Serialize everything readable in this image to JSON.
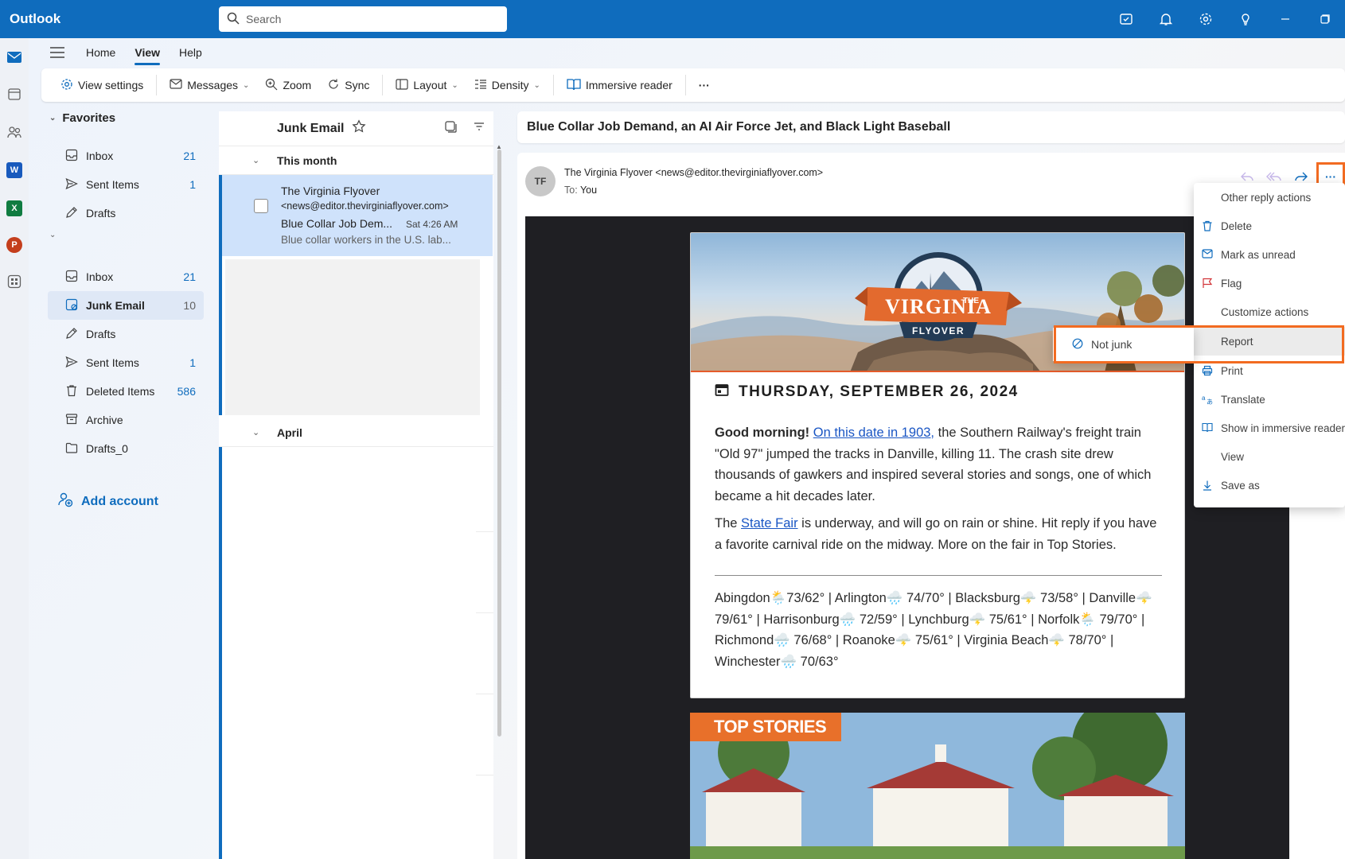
{
  "app": {
    "name": "Outlook"
  },
  "search": {
    "placeholder": "Search"
  },
  "titlebar": {
    "icons": [
      "my-day-icon",
      "bell-icon",
      "gear-icon",
      "lightbulb-icon",
      "minimize-icon",
      "restore-icon"
    ]
  },
  "rail": {
    "apps": [
      "mail",
      "calendar",
      "people",
      "word",
      "excel",
      "powerpoint",
      "apps"
    ]
  },
  "ribbon": {
    "tabs": [
      {
        "label": "Home"
      },
      {
        "label": "View",
        "active": true
      },
      {
        "label": "Help"
      }
    ],
    "toolbar": {
      "view_settings": "View settings",
      "messages": "Messages",
      "zoom": "Zoom",
      "sync": "Sync",
      "layout": "Layout",
      "density": "Density",
      "immersive_reader": "Immersive reader",
      "more": "···"
    }
  },
  "folders": {
    "favorites_label": "Favorites",
    "favorites": [
      {
        "label": "Inbox",
        "count": "21"
      },
      {
        "label": "Sent Items",
        "count": "1"
      },
      {
        "label": "Drafts",
        "count": ""
      }
    ],
    "account": [
      {
        "label": "Inbox",
        "count": "21"
      },
      {
        "label": "Junk Email",
        "count": "10",
        "selected": true
      },
      {
        "label": "Drafts",
        "count": ""
      },
      {
        "label": "Sent Items",
        "count": "1"
      },
      {
        "label": "Deleted Items",
        "count": "586"
      },
      {
        "label": "Archive",
        "count": ""
      },
      {
        "label": "Drafts_0",
        "count": ""
      }
    ],
    "add_account": "Add account"
  },
  "message_list": {
    "title": "Junk Email",
    "groups": [
      "This month",
      "April"
    ],
    "messages": [
      {
        "from": "The Virginia Flyover",
        "address": "<news@editor.thevirginiaflyover.com>",
        "subject": "Blue Collar Job Dem...",
        "time": "Sat 4:26 AM",
        "preview": "Blue collar workers in the U.S. lab..."
      }
    ]
  },
  "reading_pane": {
    "subject": "Blue Collar Job Demand, an AI Air Force Jet, and Black Light Baseball",
    "avatar_initials": "TF",
    "sender": "The Virginia Flyover <news@editor.thevirginiaflyover.com>",
    "to_label": "To:",
    "to": "You",
    "more_actions": "···"
  },
  "email": {
    "logo_top": "THE",
    "logo_main": "VIRGINIA",
    "logo_bottom": "FLYOVER",
    "date": "THURSDAY, SEPTEMBER 26, 2024",
    "greeting": "Good morning!",
    "link1": "On this date in 1903,",
    "para1_rest": " the Southern Railway's freight train \"Old 97\" jumped the tracks in Danville, killing 11. The crash site drew thousands of gawkers and inspired several stories and songs, one of which became a hit decades later.",
    "para2_start": "The ",
    "link2": "State Fair",
    "para2_rest": " is underway, and will go on rain or shine. Hit reply if you have a favorite carnival ride on the midway. More on the fair in Top Stories.",
    "weather": "Abingdon🌦️73/62° | Arlington🌧️ 74/70° | Blacksburg🌩️ 73/58° | Danville🌩️ 79/61° | Harrisonburg🌧️ 72/59° | Lynchburg🌩️ 75/61° | Norfolk🌦️ 79/70° | Richmond🌧️ 76/68° | Roanoke🌩️ 75/61° | Virginia Beach🌩️ 78/70° | Winchester🌧️ 70/63°",
    "top_stories": "TOP STORIES"
  },
  "menu": {
    "items": [
      {
        "label": "Other reply actions",
        "icon": ""
      },
      {
        "label": "Delete",
        "icon": "trash-icon"
      },
      {
        "label": "Mark as unread",
        "icon": "envelope-icon"
      },
      {
        "label": "Flag",
        "icon": "flag-icon"
      },
      {
        "label": "Customize actions",
        "icon": ""
      },
      {
        "label": "Report",
        "icon": "",
        "highlighted": true
      },
      {
        "label": "Print",
        "icon": "printer-icon"
      },
      {
        "label": "Translate",
        "icon": "translate-icon"
      },
      {
        "label": "Show in immersive reader",
        "icon": "immersive-reader-icon"
      },
      {
        "label": "View",
        "icon": ""
      },
      {
        "label": "Save as",
        "icon": "download-icon"
      }
    ],
    "submenu": {
      "label": "Not junk",
      "icon": "not-junk-icon"
    }
  },
  "colors": {
    "brand": "#0f6cbd",
    "highlight": "#f26b21"
  }
}
